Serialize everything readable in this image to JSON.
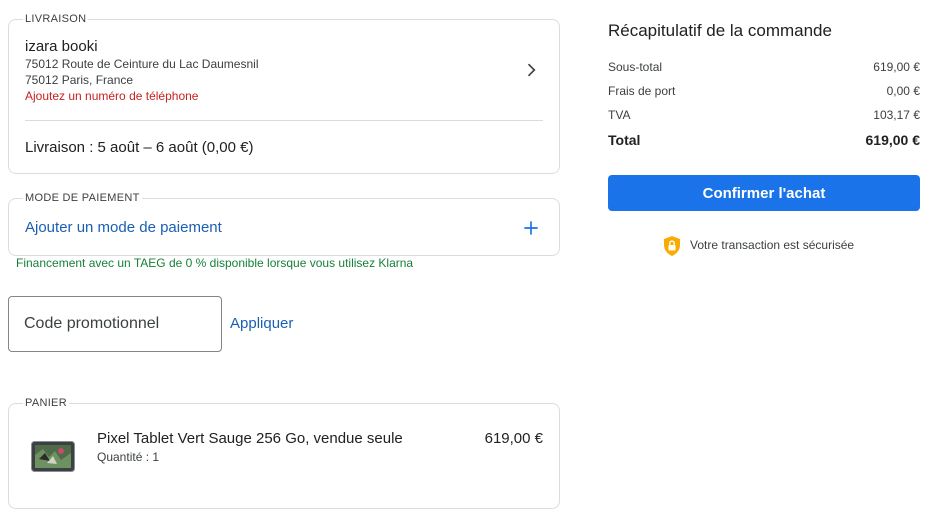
{
  "shipping": {
    "legend": "LIVRAISON",
    "name": "izara booki",
    "address_line1": "75012 Route de Ceinture du Lac Daumesnil",
    "address_line2": "75012 Paris, France",
    "add_phone": "Ajoutez un numéro de téléphone",
    "delivery": "Livraison : 5 août – 6 août (0,00 €)"
  },
  "payment": {
    "legend": "MODE DE PAIEMENT",
    "add_label": "Ajouter un mode de paiement",
    "financing": "Financement avec un TAEG de 0 % disponible lorsque vous utilisez Klarna"
  },
  "promo": {
    "placeholder": "Code promotionnel",
    "apply_label": "Appliquer"
  },
  "cart": {
    "legend": "PANIER",
    "product_name": "Pixel Tablet Vert Sauge 256 Go, vendue seule",
    "quantity": "Quantité : 1",
    "price": "619,00 €"
  },
  "summary": {
    "title": "Récapitulatif de la commande",
    "rows": [
      {
        "label": "Sous-total",
        "value": "619,00 €"
      },
      {
        "label": "Frais de port",
        "value": "0,00 €"
      },
      {
        "label": "TVA",
        "value": "103,17 €"
      }
    ],
    "total_label": "Total",
    "total_value": "619,00 €",
    "confirm_label": "Confirmer l'achat",
    "secure_text": "Votre transaction est sécurisée"
  },
  "icons": {
    "chevron": "chevron-right-icon",
    "plus": "plus-icon",
    "shield": "shield-lock-icon"
  },
  "colors": {
    "accent": "#1a73e8",
    "link": "#1a5fb4",
    "error": "#c5221f",
    "success": "#188038",
    "shield": "#f9ab00"
  }
}
